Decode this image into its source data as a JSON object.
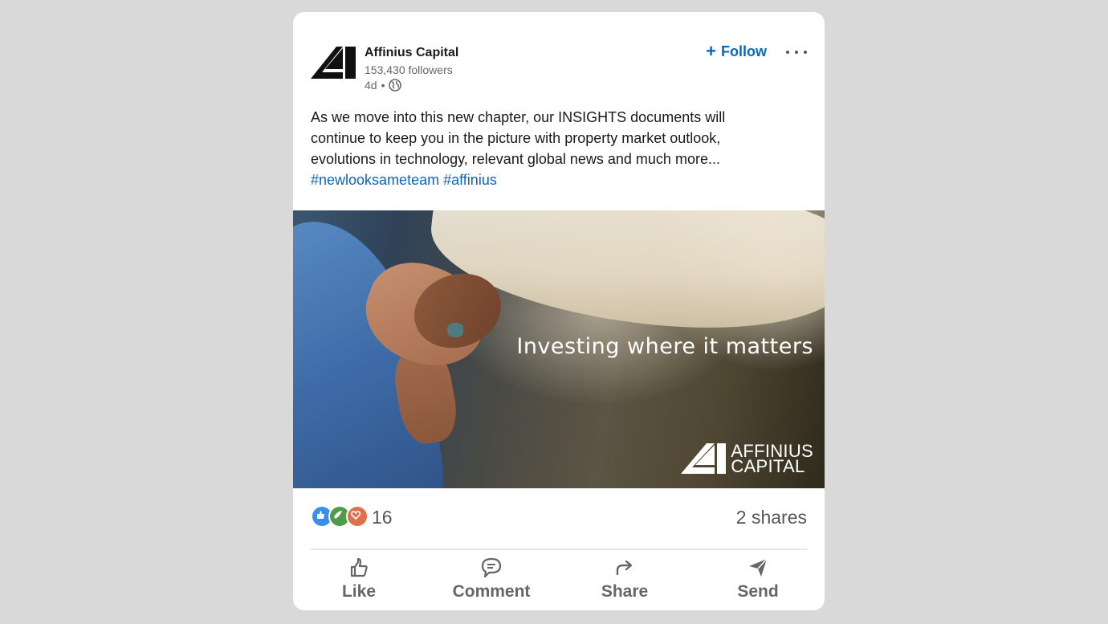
{
  "post": {
    "author": {
      "name": "Affinius Capital",
      "followers": "153,430 followers",
      "age": "4d",
      "separator": "•"
    },
    "follow_label": "Follow",
    "follow_prefix": "+",
    "text": "As we move into this new chapter, our INSIGHTS documents will continue to keep you in the picture with property market outlook, evolutions in technology, relevant global news and much more...",
    "hashtags": [
      "#newlooksameteam",
      "#affinius"
    ],
    "image": {
      "tagline": "Investing where it matters",
      "brand_line1": "AFFINIUS",
      "brand_line2": "CAPITAL"
    },
    "reactions": {
      "icons": [
        "like-reaction-icon",
        "support-reaction-icon",
        "love-reaction-icon"
      ],
      "count": "16"
    },
    "shares": "2 shares"
  },
  "actions": [
    {
      "label": "Like",
      "icon": "thumbs-up-icon"
    },
    {
      "label": "Comment",
      "icon": "comment-icon"
    },
    {
      "label": "Share",
      "icon": "share-arrow-icon"
    },
    {
      "label": "Send",
      "icon": "send-icon"
    }
  ],
  "colors": {
    "link": "#0a66c2",
    "background": "#d9d9d9",
    "card": "#ffffff",
    "muted": "#666666"
  }
}
